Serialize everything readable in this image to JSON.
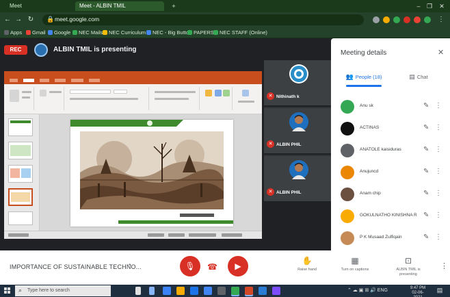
{
  "colors": {
    "accent": "#1a73e8",
    "danger": "#d93025",
    "ppt_orange": "#c94e1e",
    "slide_green": "#3f8a2c",
    "browser_green": "#24422a"
  },
  "browser": {
    "tabs": [
      "Meet",
      "Meet - ALBIN TMIL",
      "+"
    ],
    "url": "meet.google.com",
    "bookmarks": [
      "Apps",
      "Gmail",
      "Google",
      "NEC Mails",
      "NEC Curriculum",
      "NEC - Big Button",
      "PAPERS",
      "NEC STAFF (Online)"
    ]
  },
  "presenter": {
    "live_label": "REC",
    "text": "ALBIN TMIL is presenting"
  },
  "tiles": [
    {
      "name": "Nithinath k",
      "avatar_color": "#ffffff"
    },
    {
      "name": "ALBIN PHIL",
      "avatar_color": "#1f6fbf"
    },
    {
      "name": "ALBIN PHIL",
      "avatar_color": "#1f6fbf"
    }
  ],
  "panel": {
    "title": "Meeting details",
    "tabs": {
      "people": "People (18)",
      "chat": "Chat"
    },
    "participants": [
      {
        "name": "Anu sk",
        "avatar_color": "#34a853"
      },
      {
        "name": "ACTINAS",
        "avatar_color": "#111111"
      },
      {
        "name": "ANATOLE kaisiduras",
        "avatar_color": "#5f6368"
      },
      {
        "name": "Anujuncd",
        "avatar_color": "#ea8600"
      },
      {
        "name": "Anam chip",
        "avatar_color": "#6b4f3f"
      },
      {
        "name": "GOKULNATHO KINISHNA R",
        "avatar_color": "#f9ab00"
      },
      {
        "name": "P K Musaad Zulfiqain",
        "avatar_color": "#c58a55"
      }
    ]
  },
  "controls": {
    "meeting_title": "IMPORTANCE OF SUSTAINABLE TECHNO...",
    "mic_icon": "mic-off-icon",
    "hangup_icon": "phone-icon",
    "camera_icon": "camera-off-icon",
    "actions": [
      {
        "label": "Raise hand",
        "icon": "hand-icon"
      },
      {
        "label": "Turn on captions",
        "icon": "captions-icon"
      },
      {
        "label": "ALBIN TMIL is presenting",
        "icon": "present-icon"
      }
    ]
  },
  "taskbar": {
    "search_placeholder": "Type here to search",
    "clock_time": "9:47 PM",
    "clock_date": "02-06-2021"
  }
}
